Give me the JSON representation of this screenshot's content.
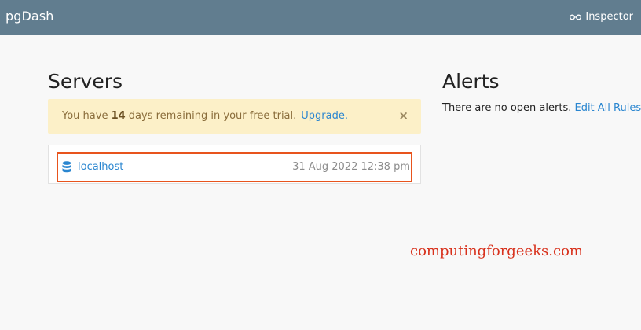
{
  "navbar": {
    "brand": "pgDash",
    "inspector_label": "Inspector",
    "inspector_icon": "glasses-icon",
    "background": "#617d8f"
  },
  "servers": {
    "title": "Servers",
    "trial_banner": {
      "prefix": "You have ",
      "days": "14",
      "suffix": " days remaining in your free trial.",
      "upgrade_link": "Upgrade.",
      "close_glyph": "×"
    },
    "items": [
      {
        "icon": "database-icon",
        "name": "localhost",
        "timestamp": "31 Aug 2022 12:38 pm"
      }
    ]
  },
  "alerts": {
    "title": "Alerts",
    "empty_text": "There are no open alerts. ",
    "edit_link": "Edit All Rules",
    "trailing": "."
  },
  "watermark": "computingforgeeks.com",
  "colors": {
    "link": "#2a86d0",
    "highlight_border": "#e8541d",
    "banner_bg": "#fcf0c8",
    "watermark": "#d8311c"
  }
}
